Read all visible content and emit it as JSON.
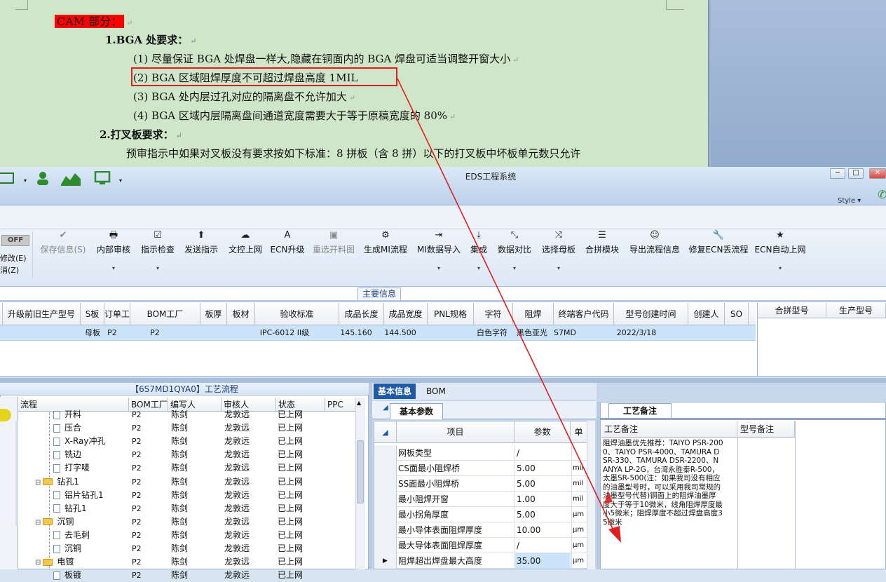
{
  "document": {
    "cam_heading": "CAM 部分：",
    "section1_title": "1.BGA 处要求：",
    "items": [
      "(1) 尽量保证 BGA 处焊盘一样大,隐藏在铜面内的 BGA 焊盘可适当调整开窗大小",
      "(2) BGA 区域阻焊厚度不可超过焊盘高度 1MIL",
      "(3) BGA 处内层过孔对应的隔离盘不允许加大",
      "(4) BGA 区域内层隔离盘间通道宽度需要大于等于原稿宽度的 80%"
    ],
    "section2_title": "2.打叉板要求：",
    "section2_text": "预审指示中如果对叉板没有要求按如下标准：8 拼板（含 8 拼）以下的打叉板中坏板单元数只允许",
    "para_mark": "↵"
  },
  "app": {
    "title": "EDS工程系统",
    "style_label": "Style ▾",
    "win_min": "─",
    "win_max": "□",
    "win_close": "✕"
  },
  "toolbar": {
    "off_label": "OFF",
    "left_partial": [
      "修改(E)",
      "消(Z)"
    ],
    "buttons": [
      {
        "label": "保存信息(S)",
        "icon": "✔"
      },
      {
        "label": "内部审核",
        "icon": "🖶"
      },
      {
        "label": "指示检查",
        "icon": "☑"
      },
      {
        "label": "发送指示",
        "icon": "⬆"
      },
      {
        "label": "文控上网",
        "icon": "☁"
      },
      {
        "label": "ECN升级",
        "icon": "A"
      },
      {
        "label": "重选开料图",
        "icon": "▣"
      },
      {
        "label": "生成MI流程",
        "icon": "⚙"
      },
      {
        "label": "MI数据导入",
        "icon": "⇥"
      },
      {
        "label": "集成",
        "icon": "⤓"
      },
      {
        "label": "数据对比",
        "icon": "⤡"
      },
      {
        "label": "选择母板",
        "icon": "⤨"
      },
      {
        "label": "合拼模块",
        "icon": "☰"
      },
      {
        "label": "导出流程信息",
        "icon": "☺"
      },
      {
        "label": "修复ECN丢流程",
        "icon": "🔧"
      },
      {
        "label": "ECN自动上网",
        "icon": "★"
      }
    ]
  },
  "main_info": {
    "section_label": "主要信息",
    "columns": [
      "升级前旧生产型号",
      "S板",
      "订单工厂",
      "BOM工厂",
      "板厚",
      "板材",
      "验收标准",
      "成品长度",
      "成品宽度",
      "PNL规格",
      "字符",
      "阻焊",
      "终端客户代码",
      "型号创建时间",
      "创建人",
      "SO"
    ],
    "row": {
      "board_type": "母板",
      "order_factory": "P2",
      "bom_factory": "P2",
      "standard": "IPC-6012 II级",
      "length": "145.160",
      "width": "144.500",
      "character": "白色字符",
      "solder_mask": "黑色亚光",
      "customer_code": "S7MD",
      "created": "2022/3/18"
    },
    "right_columns": [
      "合拼型号",
      "生产型号"
    ]
  },
  "process": {
    "title": "【6S7MD1QYA0】工艺流程",
    "columns": [
      "流程",
      "BOM工厂",
      "编写人",
      "审核人",
      "状态",
      "PPC"
    ],
    "rows": [
      {
        "indent": 2,
        "type": "file",
        "name": "开料",
        "bom": "P2",
        "writer": "陈剑",
        "reviewer": "龙敦远",
        "status": "已上网"
      },
      {
        "indent": 2,
        "type": "file",
        "name": "压合",
        "bom": "P2",
        "writer": "陈剑",
        "reviewer": "龙敦远",
        "status": "已上网"
      },
      {
        "indent": 2,
        "type": "file",
        "name": "X-Ray冲孔",
        "bom": "P2",
        "writer": "陈剑",
        "reviewer": "龙敦远",
        "status": "已上网"
      },
      {
        "indent": 2,
        "type": "file",
        "name": "铣边",
        "bom": "P2",
        "writer": "陈剑",
        "reviewer": "龙敦远",
        "status": "已上网"
      },
      {
        "indent": 2,
        "type": "file",
        "name": "打字唛",
        "bom": "P2",
        "writer": "陈剑",
        "reviewer": "龙敦远",
        "status": "已上网"
      },
      {
        "indent": 1,
        "type": "folder",
        "name": "钻孔1",
        "bom": "P2",
        "writer": "陈剑",
        "reviewer": "龙敦远",
        "status": "已上网"
      },
      {
        "indent": 2,
        "type": "file",
        "name": "铝片钻孔1",
        "bom": "P2",
        "writer": "陈剑",
        "reviewer": "龙敦远",
        "status": "已上网"
      },
      {
        "indent": 2,
        "type": "file",
        "name": "钻孔1",
        "bom": "P2",
        "writer": "陈剑",
        "reviewer": "龙敦远",
        "status": "已上网"
      },
      {
        "indent": 1,
        "type": "folder",
        "name": "沉铜",
        "bom": "P2",
        "writer": "陈剑",
        "reviewer": "龙敦远",
        "status": "已上网"
      },
      {
        "indent": 2,
        "type": "file",
        "name": "去毛刺",
        "bom": "P2",
        "writer": "陈剑",
        "reviewer": "龙敦远",
        "status": "已上网"
      },
      {
        "indent": 2,
        "type": "file",
        "name": "沉铜",
        "bom": "P2",
        "writer": "陈剑",
        "reviewer": "龙敦远",
        "status": "已上网"
      },
      {
        "indent": 1,
        "type": "folder",
        "name": "电镀",
        "bom": "P2",
        "writer": "陈剑",
        "reviewer": "龙敦远",
        "status": "已上网"
      },
      {
        "indent": 2,
        "type": "file",
        "name": "板镀",
        "bom": "P2",
        "writer": "陈剑",
        "reviewer": "龙敦远",
        "status": "已上网"
      }
    ]
  },
  "basic": {
    "tabs": [
      "基本信息",
      "BOM"
    ],
    "subtab": "基本参数",
    "columns": [
      "项目",
      "参数",
      "单"
    ],
    "rows": [
      {
        "item": "网板类型",
        "value": "/",
        "unit": ""
      },
      {
        "item": "CS面最小阻焊桥",
        "value": "5.00",
        "unit": "mil"
      },
      {
        "item": "SS面最小阻焊桥",
        "value": "5.00",
        "unit": "mil"
      },
      {
        "item": "最小阻焊开窗",
        "value": "1.00",
        "unit": "mil"
      },
      {
        "item": "最小拐角厚度",
        "value": "5.00",
        "unit": "μm"
      },
      {
        "item": "最小导体表面阻焊厚度",
        "value": "10.00",
        "unit": "μm"
      },
      {
        "item": "最大导体表面阻焊厚度",
        "value": "/",
        "unit": "μm"
      },
      {
        "item": "阻焊超出焊盘最大高度",
        "value": "35.00",
        "unit": "μm"
      }
    ]
  },
  "notes": {
    "tab": "工艺备注",
    "columns": [
      "工艺备注",
      "型号备注"
    ],
    "text": "阻焊油墨优先推荐：TAIYO PSR-2000、TAIYO PSR-4000、TAMURA DSR-330、TAMURA DSR-2200、NANYA LP-2G，台湾永胜泰R-500，太墨SR-500(注：如果我司没有相应的油墨型号时，可以采用我司常规的油墨型号代替)铜面上的阻焊油墨厚度大于等于10微米，线角阻焊厚度最小5微米；阻焊厚度不超过焊盘高度35微米"
  },
  "colors": {
    "accent": "#1f5aa8",
    "annotation_red": "#e02020",
    "doc_bg": "#cfe6c9",
    "selected_row": "#cce4fa"
  }
}
